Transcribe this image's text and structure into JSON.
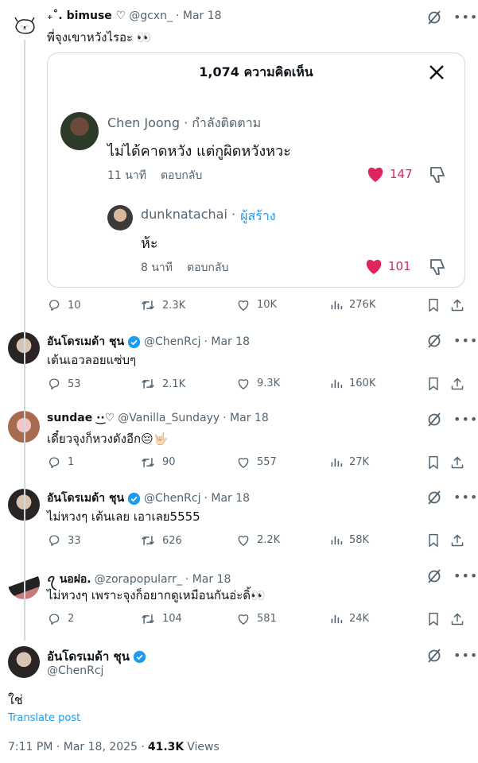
{
  "colors": {
    "accent": "#1d9bf0",
    "like": "#f91880",
    "muted": "#536471",
    "border": "#cfd9de"
  },
  "top_tweet": {
    "name": "₊˚. bimuse ♡",
    "handle": "@gcxn_",
    "date": "· Mar 18",
    "text": "พี่จุงเขาหวังไรอะ 👀",
    "card": {
      "title": "1,074 ความคิดเห็น",
      "comment": {
        "name": "Chen Joong · กำลังติดตาม",
        "text": "ไม่ได้คาดหวัง แต่กูผิดหวังหวะ",
        "time": "11 นาที",
        "reply": "ตอบกลับ",
        "likes": "147"
      },
      "reply": {
        "name": "dunknatachai ·",
        "creator": "ผู้สร้าง",
        "text": "ห้ะ",
        "time": "8 นาที",
        "reply": "ตอบกลับ",
        "likes": "101"
      }
    },
    "stats": {
      "replies": "10",
      "reposts": "2.3K",
      "likes": "10K",
      "views": "276K"
    }
  },
  "replies": [
    {
      "name": "อันโดรเมด้า ชุน",
      "verified": true,
      "handle": "@ChenRcj",
      "date": "· Mar 18",
      "text": "เต้นเอวลอยแซ่บๆ",
      "stats": {
        "replies": "53",
        "reposts": "2.1K",
        "likes": "9.3K",
        "views": "160K"
      }
    },
    {
      "name": "sundae ·͜·♡",
      "verified": false,
      "handle": "@Vanilla_Sundayy",
      "date": "· Mar 18",
      "text": "เดี๋ยวจุงก็หวงดังอีก😔🤟🏻",
      "stats": {
        "replies": "1",
        "reposts": "90",
        "likes": "557",
        "views": "27K"
      }
    },
    {
      "name": "อันโดรเมด้า ชุน",
      "verified": true,
      "handle": "@ChenRcj",
      "date": "· Mar 18",
      "text": "ไม่หวงๆ เต้นเลย เอาเลย5555",
      "stats": {
        "replies": "33",
        "reposts": "626",
        "likes": "2.2K",
        "views": "58K"
      }
    },
    {
      "name": "ꪖ นอฝอ.",
      "verified": false,
      "handle": "@zorapopularr_",
      "date": "· Mar 18",
      "text": "ไม่หวงๆ เพราะจุงก็อยากดูเหมือนกันอ่ะดิ้👀",
      "stats": {
        "replies": "2",
        "reposts": "104",
        "likes": "581",
        "views": "24K"
      }
    }
  ],
  "main": {
    "name": "อันโดรเมด้า ชุน",
    "handle": "@ChenRcj",
    "text": "ใช่",
    "translate": "Translate post",
    "timestamp": "7:11 PM · Mar 18, 2025 ·",
    "views_count": "41.3K",
    "views_label": "Views"
  }
}
